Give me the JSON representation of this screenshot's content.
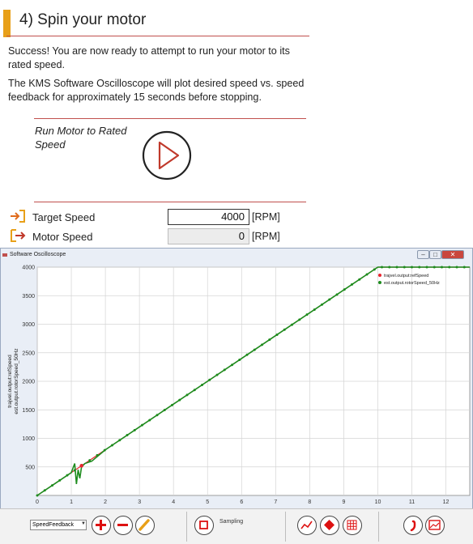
{
  "step": {
    "title": "4) Spin your motor"
  },
  "intro": {
    "success": "Success! You are now ready to attempt to run your motor to its rated speed.",
    "description": "The KMS Software Oscilloscope will plot desired speed vs. speed feedback for approximately 15 seconds before stopping."
  },
  "run": {
    "label": "Run Motor to Rated Speed"
  },
  "fields": {
    "target": {
      "label": "Target Speed",
      "value": "4000",
      "unit": "[RPM]"
    },
    "motor": {
      "label": "Motor Speed",
      "value": "0",
      "unit": "[RPM]"
    }
  },
  "oscilloscope": {
    "title": "Software Oscilloscope",
    "window_buttons": [
      "–",
      "□",
      "✕"
    ],
    "toolbar": {
      "signal_select": "SpeedFeedback",
      "sampling_label": "Sampling"
    }
  },
  "colors": {
    "accent": "#e8a019",
    "rule": "#c0504d",
    "play": "#c0392b",
    "series1": "#e8252f",
    "series2": "#1e8c1e"
  },
  "icons": {
    "target": "arrow-in-icon",
    "motor": "arrow-out-icon",
    "play": "play-icon"
  },
  "chart_data": {
    "type": "line",
    "title": "",
    "xlabel": "",
    "ylabel": "trajvel.output:refSpeed, est.output.rotorSpeed_50Hz",
    "xlim": [
      0,
      12.7
    ],
    "ylim": [
      0,
      4000
    ],
    "xticks": [
      0,
      1,
      2,
      3,
      4,
      5,
      6,
      7,
      8,
      9,
      10,
      11,
      12
    ],
    "yticks": [
      500,
      1000,
      1500,
      2000,
      2500,
      3000,
      3500,
      4000
    ],
    "grid": true,
    "legend_position": "top-right",
    "series": [
      {
        "name": "trajvel.output:refSpeed",
        "color": "#e8252f",
        "x": [
          0,
          1.0,
          1.3,
          10.0,
          12.7
        ],
        "y": [
          0,
          400,
          520,
          4000,
          4000
        ]
      },
      {
        "name": "est.output.rotorSpeed_50Hz",
        "color": "#1e8c1e",
        "x": [
          0,
          0.5,
          1.0,
          1.1,
          1.15,
          1.2,
          1.25,
          1.3,
          1.4,
          1.6,
          1.8,
          2,
          3,
          4,
          5,
          6,
          7,
          8,
          9,
          10,
          10.1,
          11,
          12,
          12.7
        ],
        "y": [
          0,
          200,
          400,
          560,
          200,
          450,
          300,
          500,
          560,
          600,
          700,
          800,
          1200,
          1600,
          2000,
          2400,
          2800,
          3200,
          3600,
          4000,
          4000,
          4000,
          4000,
          4000
        ]
      }
    ]
  }
}
